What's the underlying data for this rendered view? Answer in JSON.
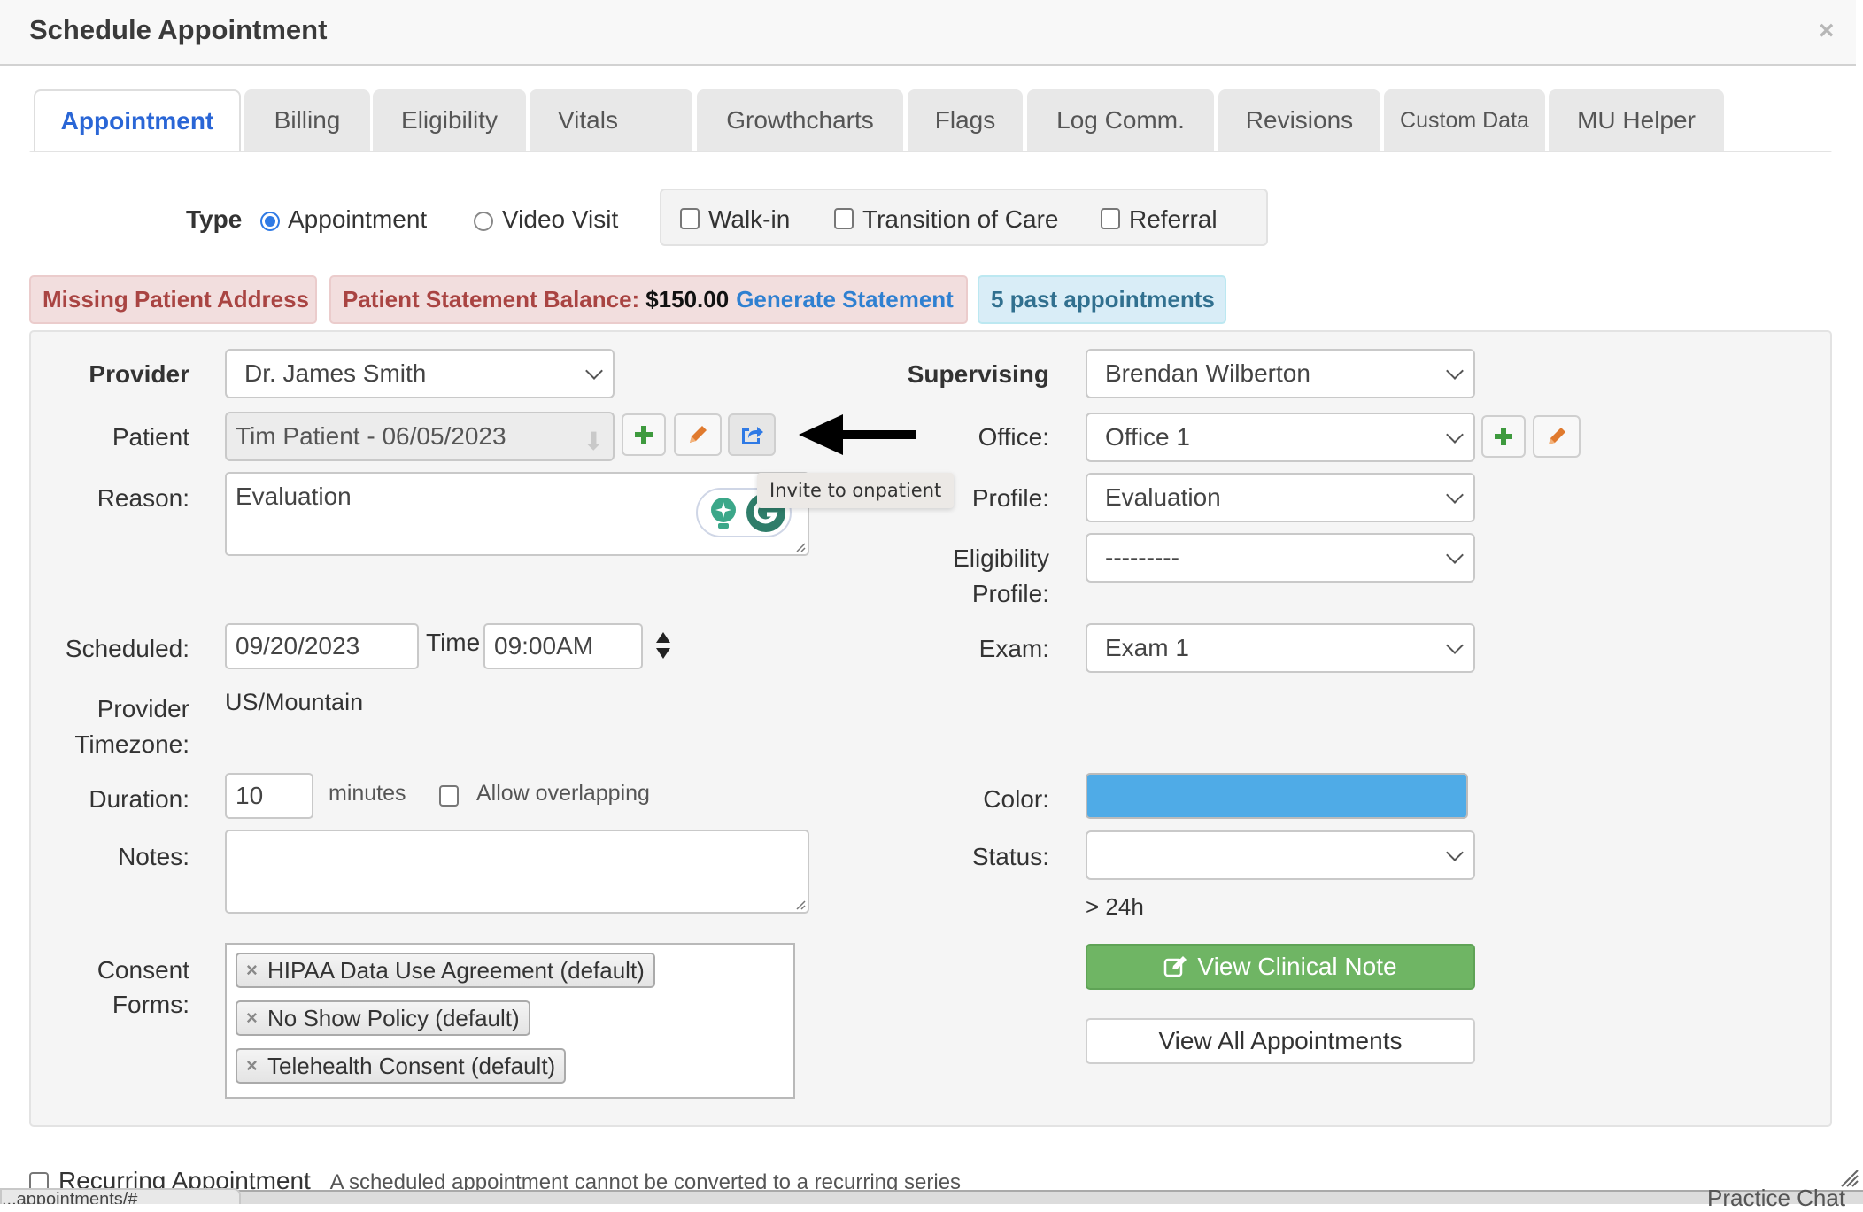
{
  "modal": {
    "title": "Schedule Appointment",
    "close_label": "×"
  },
  "tabs": [
    {
      "label": "Appointment",
      "active": true
    },
    {
      "label": "Billing",
      "active": false
    },
    {
      "label": "Eligibility",
      "active": false
    },
    {
      "label": "Vitals",
      "active": false
    },
    {
      "label": "Growthcharts",
      "active": false
    },
    {
      "label": "Flags",
      "active": false
    },
    {
      "label": "Log Comm.",
      "active": false
    },
    {
      "label": "Revisions",
      "active": false
    },
    {
      "label": "Custom Data",
      "active": false
    },
    {
      "label": "MU Helper",
      "active": false
    }
  ],
  "type_row": {
    "label": "Type",
    "radios": [
      {
        "label": "Appointment",
        "checked": true
      },
      {
        "label": "Video Visit",
        "checked": false
      }
    ],
    "checkboxes": [
      {
        "label": "Walk-in",
        "checked": false
      },
      {
        "label": "Transition of Care",
        "checked": false
      },
      {
        "label": "Referral",
        "checked": false
      }
    ]
  },
  "alerts": {
    "missing_address": "Missing Patient Address",
    "statement_label": "Patient Statement Balance:",
    "statement_amount": "$150.00",
    "generate_statement": "Generate Statement",
    "past_appointments": "5 past appointments"
  },
  "form": {
    "provider": {
      "label": "Provider",
      "value": "Dr. James Smith"
    },
    "patient": {
      "label": "Patient",
      "value": "Tim Patient - 06/05/2023"
    },
    "reason": {
      "label": "Reason:",
      "value": "Evaluation"
    },
    "tooltip": "Invite to onpatient",
    "scheduled": {
      "label": "Scheduled:",
      "date": "09/20/2023",
      "time_label": "Time",
      "time": "09:00AM"
    },
    "timezone": {
      "label_line1": "Provider",
      "label_line2": "Timezone:",
      "value": "US/Mountain"
    },
    "duration": {
      "label": "Duration:",
      "value": "10",
      "unit": "minutes",
      "allow_overlapping_label": "Allow overlapping",
      "allow_overlapping": false
    },
    "notes": {
      "label": "Notes:",
      "value": ""
    },
    "consent": {
      "label_line1": "Consent",
      "label_line2": "Forms:",
      "items": [
        "HIPAA Data Use Agreement (default)",
        "No Show Policy (default)",
        "Telehealth Consent (default)"
      ]
    },
    "supervising": {
      "label": "Supervising",
      "value": "Brendan Wilberton"
    },
    "office": {
      "label": "Office:",
      "value": "Office 1"
    },
    "profile": {
      "label": "Profile:",
      "value": "Evaluation"
    },
    "eligibility_profile": {
      "label_line1": "Eligibility",
      "label_line2": "Profile:",
      "value": "---------"
    },
    "exam": {
      "label": "Exam:",
      "value": "Exam 1"
    },
    "color": {
      "label": "Color:",
      "value": "#4fabe7"
    },
    "status": {
      "label": "Status:",
      "value": "",
      "note": "> 24h"
    },
    "view_clinical_note": "View Clinical Note",
    "view_all_appointments": "View All Appointments"
  },
  "footer": {
    "recurring_label": "Recurring Appointment",
    "recurring_hint": "A scheduled appointment cannot be converted to a recurring series",
    "url_fragment": "...appointments/#",
    "practice_chat": "Practice Chat"
  },
  "colors": {
    "accent_blue": "#2a66d6",
    "danger_text": "#a94442",
    "info_text": "#31708f",
    "success_green": "#6fb564",
    "edit_orange": "#e07a2e",
    "add_green": "#3e9a3e"
  }
}
